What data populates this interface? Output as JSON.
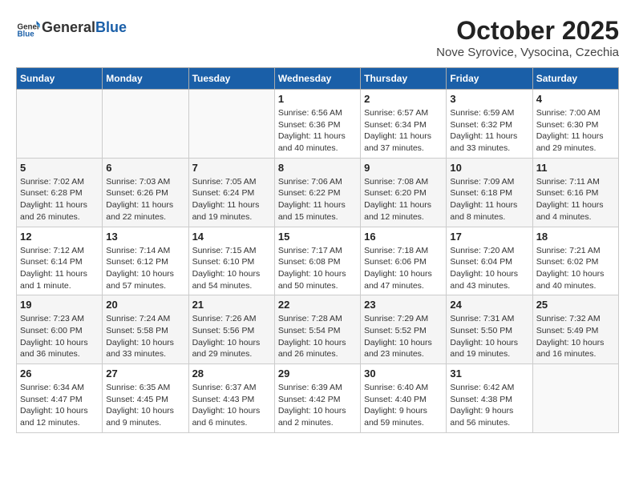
{
  "header": {
    "logo_general": "General",
    "logo_blue": "Blue",
    "month_title": "October 2025",
    "location": "Nove Syrovice, Vysocina, Czechia"
  },
  "weekdays": [
    "Sunday",
    "Monday",
    "Tuesday",
    "Wednesday",
    "Thursday",
    "Friday",
    "Saturday"
  ],
  "weeks": [
    [
      {
        "day": "",
        "info": ""
      },
      {
        "day": "",
        "info": ""
      },
      {
        "day": "",
        "info": ""
      },
      {
        "day": "1",
        "info": "Sunrise: 6:56 AM\nSunset: 6:36 PM\nDaylight: 11 hours\nand 40 minutes."
      },
      {
        "day": "2",
        "info": "Sunrise: 6:57 AM\nSunset: 6:34 PM\nDaylight: 11 hours\nand 37 minutes."
      },
      {
        "day": "3",
        "info": "Sunrise: 6:59 AM\nSunset: 6:32 PM\nDaylight: 11 hours\nand 33 minutes."
      },
      {
        "day": "4",
        "info": "Sunrise: 7:00 AM\nSunset: 6:30 PM\nDaylight: 11 hours\nand 29 minutes."
      }
    ],
    [
      {
        "day": "5",
        "info": "Sunrise: 7:02 AM\nSunset: 6:28 PM\nDaylight: 11 hours\nand 26 minutes."
      },
      {
        "day": "6",
        "info": "Sunrise: 7:03 AM\nSunset: 6:26 PM\nDaylight: 11 hours\nand 22 minutes."
      },
      {
        "day": "7",
        "info": "Sunrise: 7:05 AM\nSunset: 6:24 PM\nDaylight: 11 hours\nand 19 minutes."
      },
      {
        "day": "8",
        "info": "Sunrise: 7:06 AM\nSunset: 6:22 PM\nDaylight: 11 hours\nand 15 minutes."
      },
      {
        "day": "9",
        "info": "Sunrise: 7:08 AM\nSunset: 6:20 PM\nDaylight: 11 hours\nand 12 minutes."
      },
      {
        "day": "10",
        "info": "Sunrise: 7:09 AM\nSunset: 6:18 PM\nDaylight: 11 hours\nand 8 minutes."
      },
      {
        "day": "11",
        "info": "Sunrise: 7:11 AM\nSunset: 6:16 PM\nDaylight: 11 hours\nand 4 minutes."
      }
    ],
    [
      {
        "day": "12",
        "info": "Sunrise: 7:12 AM\nSunset: 6:14 PM\nDaylight: 11 hours\nand 1 minute."
      },
      {
        "day": "13",
        "info": "Sunrise: 7:14 AM\nSunset: 6:12 PM\nDaylight: 10 hours\nand 57 minutes."
      },
      {
        "day": "14",
        "info": "Sunrise: 7:15 AM\nSunset: 6:10 PM\nDaylight: 10 hours\nand 54 minutes."
      },
      {
        "day": "15",
        "info": "Sunrise: 7:17 AM\nSunset: 6:08 PM\nDaylight: 10 hours\nand 50 minutes."
      },
      {
        "day": "16",
        "info": "Sunrise: 7:18 AM\nSunset: 6:06 PM\nDaylight: 10 hours\nand 47 minutes."
      },
      {
        "day": "17",
        "info": "Sunrise: 7:20 AM\nSunset: 6:04 PM\nDaylight: 10 hours\nand 43 minutes."
      },
      {
        "day": "18",
        "info": "Sunrise: 7:21 AM\nSunset: 6:02 PM\nDaylight: 10 hours\nand 40 minutes."
      }
    ],
    [
      {
        "day": "19",
        "info": "Sunrise: 7:23 AM\nSunset: 6:00 PM\nDaylight: 10 hours\nand 36 minutes."
      },
      {
        "day": "20",
        "info": "Sunrise: 7:24 AM\nSunset: 5:58 PM\nDaylight: 10 hours\nand 33 minutes."
      },
      {
        "day": "21",
        "info": "Sunrise: 7:26 AM\nSunset: 5:56 PM\nDaylight: 10 hours\nand 29 minutes."
      },
      {
        "day": "22",
        "info": "Sunrise: 7:28 AM\nSunset: 5:54 PM\nDaylight: 10 hours\nand 26 minutes."
      },
      {
        "day": "23",
        "info": "Sunrise: 7:29 AM\nSunset: 5:52 PM\nDaylight: 10 hours\nand 23 minutes."
      },
      {
        "day": "24",
        "info": "Sunrise: 7:31 AM\nSunset: 5:50 PM\nDaylight: 10 hours\nand 19 minutes."
      },
      {
        "day": "25",
        "info": "Sunrise: 7:32 AM\nSunset: 5:49 PM\nDaylight: 10 hours\nand 16 minutes."
      }
    ],
    [
      {
        "day": "26",
        "info": "Sunrise: 6:34 AM\nSunset: 4:47 PM\nDaylight: 10 hours\nand 12 minutes."
      },
      {
        "day": "27",
        "info": "Sunrise: 6:35 AM\nSunset: 4:45 PM\nDaylight: 10 hours\nand 9 minutes."
      },
      {
        "day": "28",
        "info": "Sunrise: 6:37 AM\nSunset: 4:43 PM\nDaylight: 10 hours\nand 6 minutes."
      },
      {
        "day": "29",
        "info": "Sunrise: 6:39 AM\nSunset: 4:42 PM\nDaylight: 10 hours\nand 2 minutes."
      },
      {
        "day": "30",
        "info": "Sunrise: 6:40 AM\nSunset: 4:40 PM\nDaylight: 9 hours\nand 59 minutes."
      },
      {
        "day": "31",
        "info": "Sunrise: 6:42 AM\nSunset: 4:38 PM\nDaylight: 9 hours\nand 56 minutes."
      },
      {
        "day": "",
        "info": ""
      }
    ]
  ]
}
